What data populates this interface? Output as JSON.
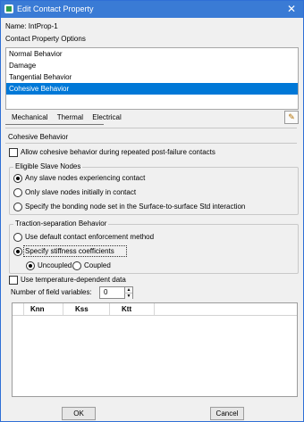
{
  "window": {
    "title": "Edit Contact Property",
    "close_glyph": "✕"
  },
  "name_row": {
    "label": "Name:",
    "value": "IntProp-1"
  },
  "options": {
    "label": "Contact Property Options",
    "items": [
      "Normal Behavior",
      "Damage",
      "Tangential Behavior",
      "Cohesive Behavior"
    ],
    "selected_index": 3
  },
  "tabs": [
    "Mechanical",
    "Thermal",
    "Electrical"
  ],
  "cohesive": {
    "heading": "Cohesive Behavior",
    "allow_label": "Allow cohesive behavior during repeated post-failure contacts",
    "allow_checked": false,
    "slave": {
      "title": "Eligible Slave Nodes",
      "options": [
        "Any slave nodes experiencing contact",
        "Only slave nodes initially in contact",
        "Specify the bonding node set in the Surface-to-surface Std interaction"
      ],
      "selected_index": 0
    },
    "traction": {
      "title": "Traction-separation Behavior",
      "default_label": "Use default contact enforcement method",
      "specify_label": "Specify stiffness coefficients",
      "selected": "specify",
      "coupling": [
        "Uncoupled",
        "Coupled"
      ],
      "coupling_selected": 0
    },
    "temp_label": "Use temperature-dependent data",
    "temp_checked": false,
    "fields_label": "Number of field variables:",
    "fields_value": "0"
  },
  "table": {
    "columns": [
      "Knn",
      "Kss",
      "Ktt"
    ]
  },
  "buttons": {
    "ok": "OK",
    "cancel": "Cancel"
  },
  "colors": {
    "titlebar": "#3a7bd5",
    "selection": "#0078d7"
  },
  "icons": {
    "wrench": "wrench-icon"
  }
}
